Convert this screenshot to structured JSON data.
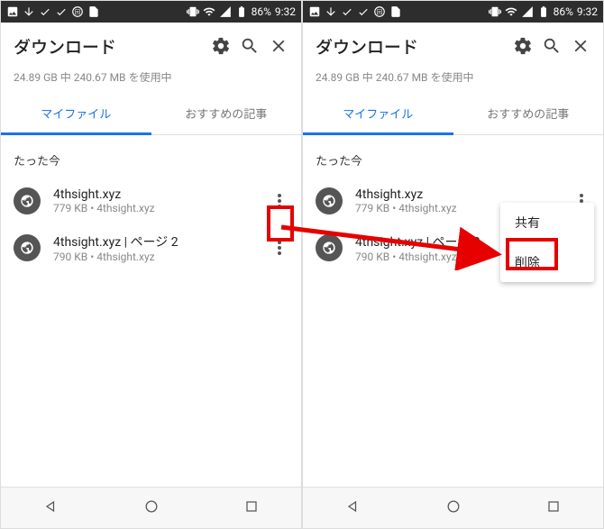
{
  "status_bar": {
    "battery_text": "86%",
    "clock": "9:32"
  },
  "header": {
    "title": "ダウンロード"
  },
  "storage_text": "24.89 GB 中 240.67 MB を使用中",
  "tabs": {
    "my_files": "マイファイル",
    "recommended": "おすすめの記事"
  },
  "section_label": "たった今",
  "files": [
    {
      "title": "4thsight.xyz",
      "sub": "779 KB • 4thsight.xyz"
    },
    {
      "title": "4thsight.xyz | ページ 2",
      "sub": "790 KB • 4thsight.xyz"
    }
  ],
  "menu": {
    "share": "共有",
    "delete": "削除"
  }
}
